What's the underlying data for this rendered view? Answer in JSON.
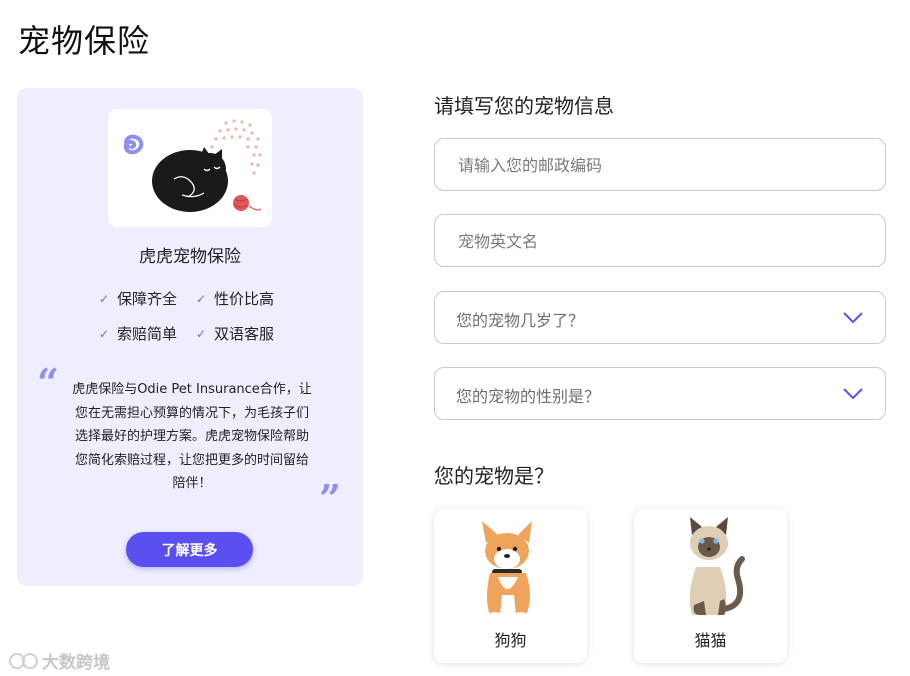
{
  "page": {
    "title": "宠物保险"
  },
  "card": {
    "product_name": "虎虎宠物保险",
    "features": [
      "保障齐全",
      "性价比高",
      "索赔简单",
      "双语客服"
    ],
    "quote_lines": [
      "虎虎保险与Odie Pet Insurance合作，让",
      "您在无需担心预算的情况下，为毛孩子们",
      "选择最好的护理方案。虎虎宠物保险帮助",
      "您简化索赔过程，让您把更多的时间留给",
      "陪伴！"
    ],
    "more_button": "了解更多"
  },
  "form": {
    "title": "请填写您的宠物信息",
    "zip_placeholder": "请输入您的邮政编码",
    "name_placeholder": "宠物英文名",
    "age_select": "您的宠物几岁了？",
    "gender_select": "您的宠物的性别是？"
  },
  "pet_type": {
    "title": "您的宠物是？",
    "options": [
      "狗狗",
      "猫猫"
    ]
  },
  "watermark": {
    "text": "大数跨境"
  },
  "colors": {
    "accent": "#5b4ff2",
    "card_bg": "#eeeefe",
    "check": "#6b6be6"
  }
}
